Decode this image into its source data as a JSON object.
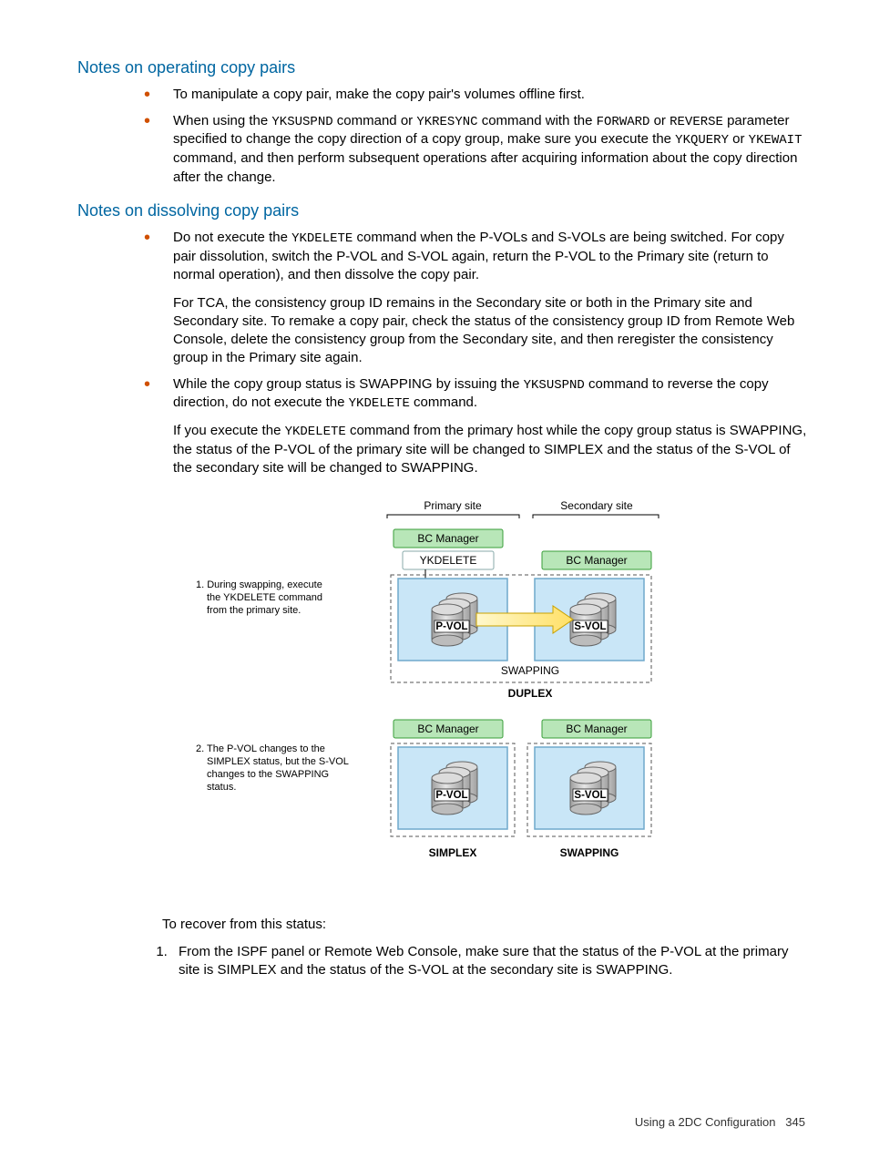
{
  "sections": {
    "s1": {
      "heading": "Notes on operating copy pairs",
      "bullets": {
        "b1": "To manipulate a copy pair, make the copy pair's volumes offline first.",
        "b2a": "When using the ",
        "b2_cmd1": "YKSUSPND",
        "b2b": " command or ",
        "b2_cmd2": "YKRESYNC",
        "b2c": " command with the ",
        "b2_cmd3": "FORWARD",
        "b2d": " or ",
        "b2_cmd4": "REVERSE",
        "b2e": " parameter specified to change the copy direction of a copy group, make sure you execute the ",
        "b2_cmd5": "YKQUERY",
        "b2f": " or ",
        "b2_cmd6": "YKEWAIT",
        "b2g": " command, and then perform subsequent operations after acquiring information about the copy direction after the change."
      }
    },
    "s2": {
      "heading": "Notes on dissolving copy pairs",
      "bullets": {
        "b1a": "Do not execute the ",
        "b1_cmd1": "YKDELETE",
        "b1b": " command when the P-VOLs and S-VOLs are being switched. For copy pair dissolution, switch the P-VOL and S-VOL again, return the P-VOL to the Primary site (return to normal operation), and then dissolve the copy pair.",
        "b1p": "For TCA, the consistency group ID remains in the Secondary site or both in the Primary site and Secondary site. To remake a copy pair, check the status of the consistency group ID from Remote Web Console, delete the consistency group from the Secondary site, and then reregister the consistency group in the Primary site again.",
        "b2a": "While the copy group status is SWAPPING by issuing the ",
        "b2_cmd1": "YKSUSPND",
        "b2b": " command to reverse the copy direction, do not execute the ",
        "b2_cmd2": "YKDELETE",
        "b2c": " command.",
        "b2p_a": "If you execute the ",
        "b2p_cmd": "YKDELETE",
        "b2p_b": " command from the primary host while the copy group status is SWAPPING, the status of the P-VOL of the primary site will be changed to SIMPLEX and the status of the S-VOL of the secondary site will be changed to SWAPPING."
      },
      "recover": "To recover from this status:",
      "step1": "From the ISPF panel or Remote Web Console, make sure that the status of the P-VOL at the primary site is SIMPLEX and the status of the S-VOL at the secondary site is SWAPPING."
    }
  },
  "diagram": {
    "primary_site": "Primary site",
    "secondary_site": "Secondary site",
    "bc_manager": "BC Manager",
    "ykdelete": "YKDELETE",
    "pvol": "P-VOL",
    "svol": "S-VOL",
    "swapping": "SWAPPING",
    "duplex": "DUPLEX",
    "simplex": "SIMPLEX",
    "note1_l1": "1. During swapping, execute",
    "note1_l2": "the YKDELETE command",
    "note1_l3": "from the primary site.",
    "note2_l1": "2. The P-VOL changes to the",
    "note2_l2": "SIMPLEX status, but the S-VOL",
    "note2_l3": "changes to the SWAPPING",
    "note2_l4": "status."
  },
  "footer": {
    "text": "Using a 2DC Configuration",
    "page": "345"
  }
}
